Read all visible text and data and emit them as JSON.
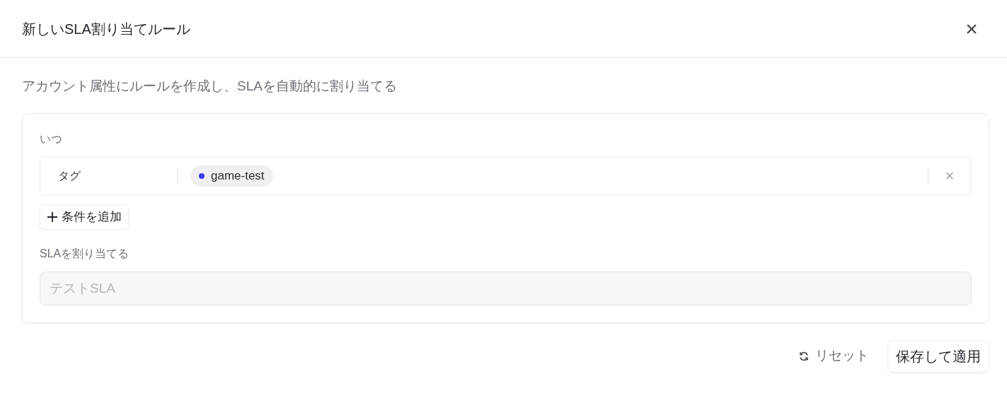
{
  "dialog": {
    "title": "新しいSLA割り当てルール",
    "close": "×"
  },
  "description": "アカウント属性にルールを作成し、SLAを自動的に割り当てる",
  "when": {
    "label": "いつ",
    "conditions": [
      {
        "field": "タグ",
        "tags": [
          {
            "label": "game-test",
            "color": "#3b3bf5"
          }
        ],
        "remove": "×"
      }
    ],
    "add_button": "条件を追加"
  },
  "assign": {
    "label": "SLAを割り当てる",
    "value": "テストSLA",
    "disabled": true
  },
  "footer": {
    "reset": "リセット",
    "save": "保存して適用"
  }
}
